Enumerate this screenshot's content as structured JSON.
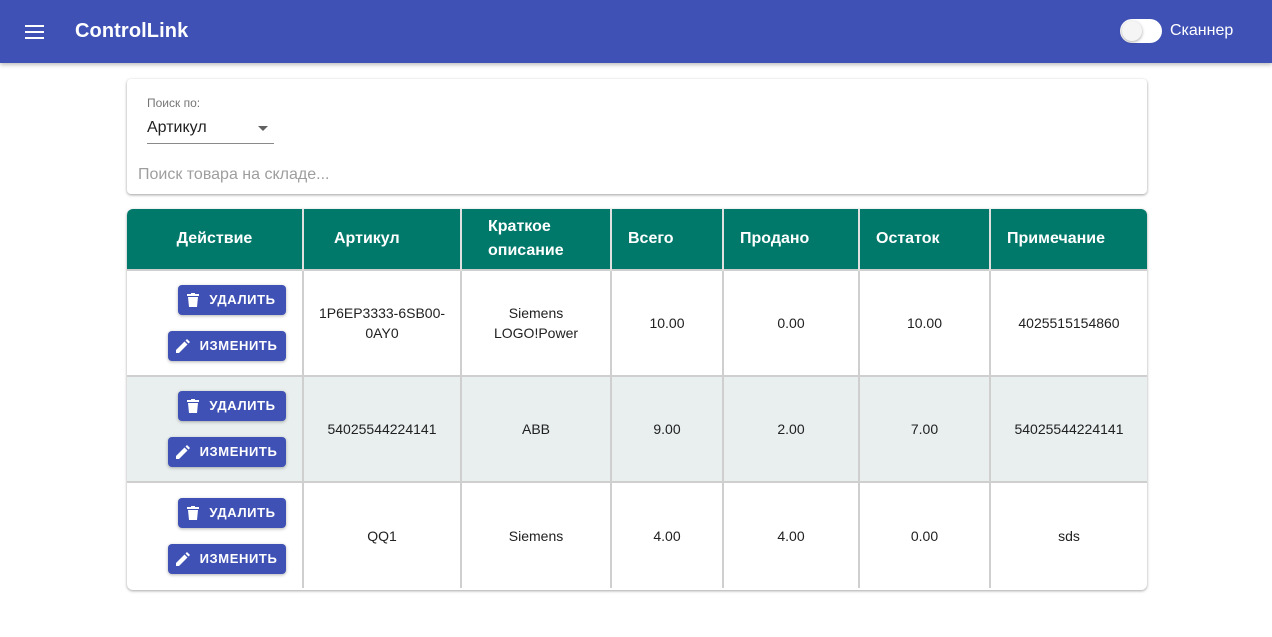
{
  "app": {
    "title": "ControlLink"
  },
  "scanner": {
    "label": "Сканнер",
    "enabled": false
  },
  "search": {
    "by_label": "Поиск по:",
    "by_value": "Артикул",
    "placeholder": "Поиск товара на складе..."
  },
  "table": {
    "headers": [
      "Действие",
      "Артикул",
      "Краткое описание",
      "Всего",
      "Продано",
      "Остаток",
      "Примечание"
    ],
    "delete_label": "УДАЛИТЬ",
    "edit_label": "ИЗМЕНИТЬ",
    "rows": [
      {
        "article": "1P6EP3333-6SB00-0AY0",
        "description": "Siemens LOGO!Power",
        "total": "10.00",
        "sold": "0.00",
        "remaining": "10.00",
        "note": "4025515154860"
      },
      {
        "article": "54025544224141",
        "description": "ABB",
        "total": "9.00",
        "sold": "2.00",
        "remaining": "7.00",
        "note": "54025544224141"
      },
      {
        "article": "QQ1",
        "description": "Siemens",
        "total": "4.00",
        "sold": "4.00",
        "remaining": "0.00",
        "note": "sds"
      }
    ]
  },
  "colors": {
    "primary": "#3f51b5",
    "table_header": "#00796b",
    "row_alt": "#e8efee"
  },
  "icons": {
    "menu": "menu-icon",
    "delete": "trash-icon",
    "edit": "pencil-icon"
  }
}
